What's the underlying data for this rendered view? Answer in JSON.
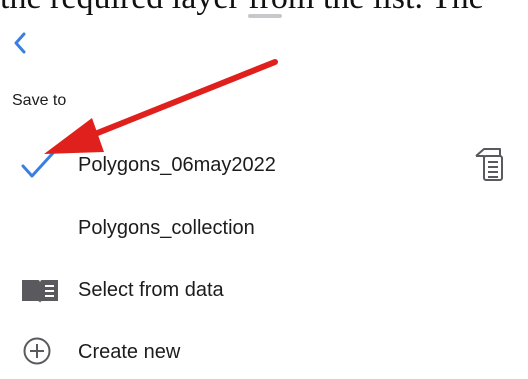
{
  "page": {
    "doc_text": "the required layer from the list. The"
  },
  "header": {
    "back_label": "‹"
  },
  "section": {
    "label": "Save to"
  },
  "layers": [
    {
      "label": "Polygons_06may2022",
      "selected": true
    },
    {
      "label": "Polygons_collection",
      "selected": false
    }
  ],
  "actions": {
    "select_from_data": "Select from data",
    "create_new": "Create new"
  },
  "icons": {
    "check": "checkmark-icon",
    "layer_info": "layer-info-icon",
    "book": "book-icon",
    "plus": "plus-circle-icon",
    "back": "chevron-left-icon"
  },
  "colors": {
    "accent": "#3a7fe0",
    "annotation_arrow": "#e0201c",
    "icon_gray": "#5a5a5e"
  }
}
